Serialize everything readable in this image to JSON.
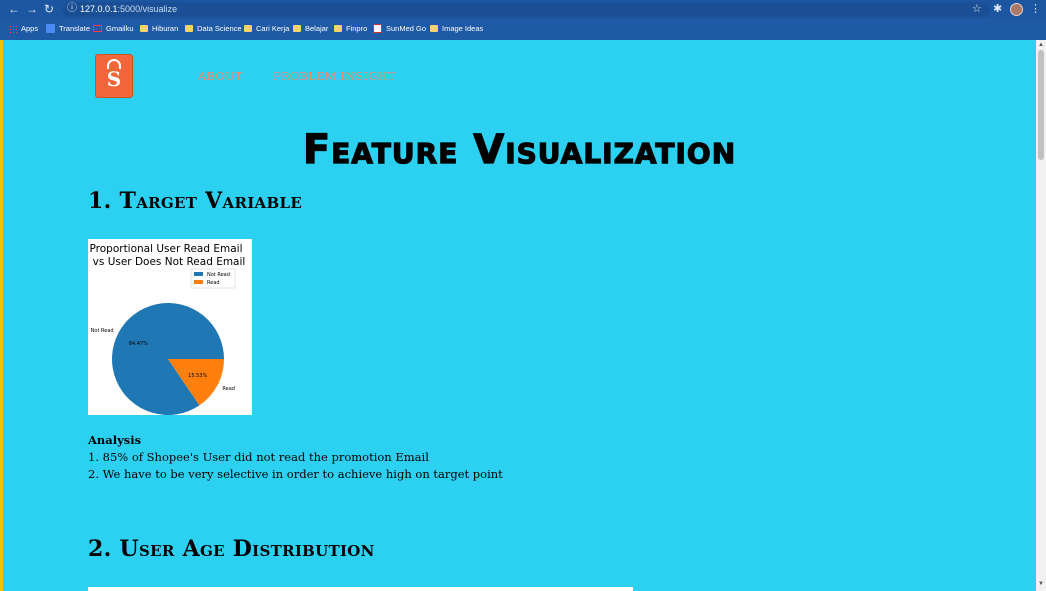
{
  "browser": {
    "url_host": "127.0.0.1",
    "url_path": ":5000/visualize",
    "bookmarks": [
      {
        "label": "Apps",
        "icon": "apps-icon"
      },
      {
        "label": "Translate",
        "icon": "translate-icon"
      },
      {
        "label": "Gmailku",
        "icon": "gmail-icon"
      },
      {
        "label": "Hiburan",
        "icon": "folder-icon"
      },
      {
        "label": "Data Science",
        "icon": "folder-icon"
      },
      {
        "label": "Cari Kerja",
        "icon": "folder-icon"
      },
      {
        "label": "Belajar",
        "icon": "folder-icon"
      },
      {
        "label": "Finpro",
        "icon": "folder-icon"
      },
      {
        "label": "SunMed Go",
        "icon": "sunmed-icon"
      },
      {
        "label": "Image Ideas",
        "icon": "folder-icon"
      }
    ]
  },
  "nav": {
    "logo_letter": "S",
    "about": "ABOUT",
    "problem": "PROBLEM INSIGHT"
  },
  "page": {
    "title": "Feature Visualization",
    "section1": "1. Target Variable",
    "section2": "2. User Age Distribution"
  },
  "chart_data": {
    "type": "pie",
    "title": "Proportional User Read Email\nvs User Does Not Read Email",
    "title_line1": "Proportional User Read Email",
    "title_line2": "vs User Does Not Read Email",
    "labels": [
      "Not Read",
      "Read"
    ],
    "values": [
      84.47,
      15.53
    ],
    "value_labels": [
      "84.47%",
      "15.53%"
    ],
    "colors": [
      "#1f77b4",
      "#ff7f0e"
    ],
    "legend": [
      "Not Read",
      "Read"
    ],
    "legend_position": "upper-right"
  },
  "analysis": {
    "heading": "Analysis",
    "items": [
      "1. 85% of Shopee's User did not read the promotion Email",
      "2. We have to be very selective in order to achieve high on target point"
    ]
  }
}
